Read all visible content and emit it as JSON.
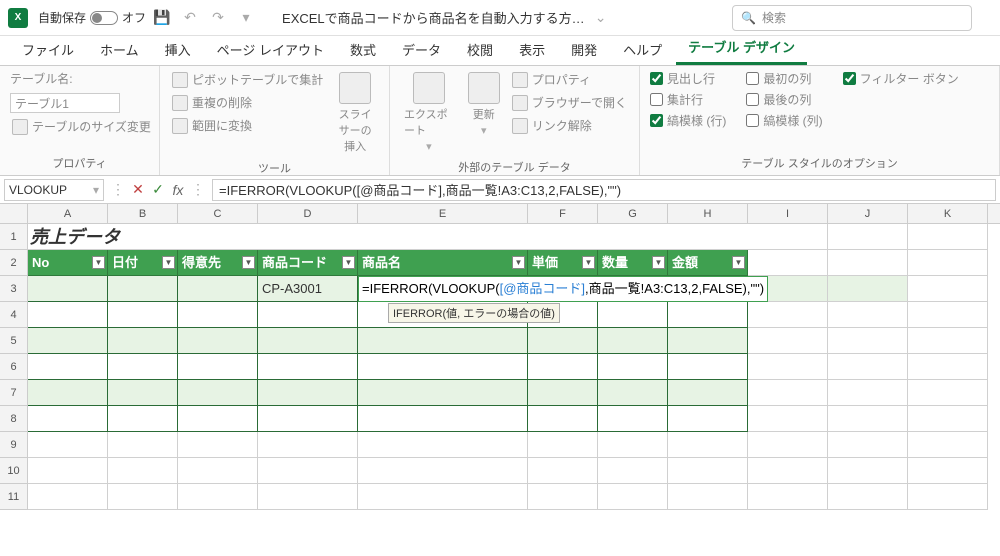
{
  "titlebar": {
    "autosave_label": "自動保存",
    "autosave_state": "オフ",
    "doc_title": "EXCELで商品コードから商品名を自動入力する方…",
    "search_placeholder": "検索"
  },
  "tabs": [
    "ファイル",
    "ホーム",
    "挿入",
    "ページ レイアウト",
    "数式",
    "データ",
    "校閲",
    "表示",
    "開発",
    "ヘルプ",
    "テーブル デザイン"
  ],
  "active_tab": 10,
  "ribbon": {
    "g1": {
      "label": "プロパティ",
      "name_label": "テーブル名:",
      "name_value": "テーブル1",
      "resize": "テーブルのサイズ変更"
    },
    "g2": {
      "label": "ツール",
      "pivot": "ピボットテーブルで集計",
      "dup": "重複の削除",
      "range": "範囲に変換",
      "slicer": "スライサーの\n挿入"
    },
    "g3": {
      "label": "外部のテーブル データ",
      "export": "エクスポート",
      "refresh": "更新",
      "prop": "プロパティ",
      "browser": "ブラウザーで開く",
      "unlink": "リンク解除"
    },
    "g4": {
      "label": "テーブル スタイルのオプション",
      "c1": "見出し行",
      "c2": "集計行",
      "c3": "縞模様 (行)",
      "c4": "最初の列",
      "c5": "最後の列",
      "c6": "縞模様 (列)",
      "c7": "フィルター ボタン"
    }
  },
  "namebox": "VLOOKUP",
  "formula_bar": "=IFERROR(VLOOKUP([@商品コード],商品一覧!A3:C13,2,FALSE),\"\")",
  "columns": [
    "A",
    "B",
    "C",
    "D",
    "E",
    "F",
    "G",
    "H",
    "I",
    "J",
    "K"
  ],
  "data_title": "売上データ",
  "headers": [
    "No",
    "日付",
    "得意先",
    "商品コード",
    "商品名",
    "単価",
    "数量",
    "金額"
  ],
  "row3": {
    "code": "CP-A3001"
  },
  "formula_parts": {
    "p1": "=IFERROR(",
    "p2": "VLOOKUP(",
    "p3": "[@商品コード]",
    "p4": ",",
    "p5": "商品一覧!A3:C13",
    "p6": ",2,FALSE),\"\")"
  },
  "tooltip": "IFERROR(値, エラーの場合の値)",
  "row_numbers": [
    1,
    2,
    3,
    4,
    5,
    6,
    7,
    8,
    9,
    10,
    11
  ]
}
